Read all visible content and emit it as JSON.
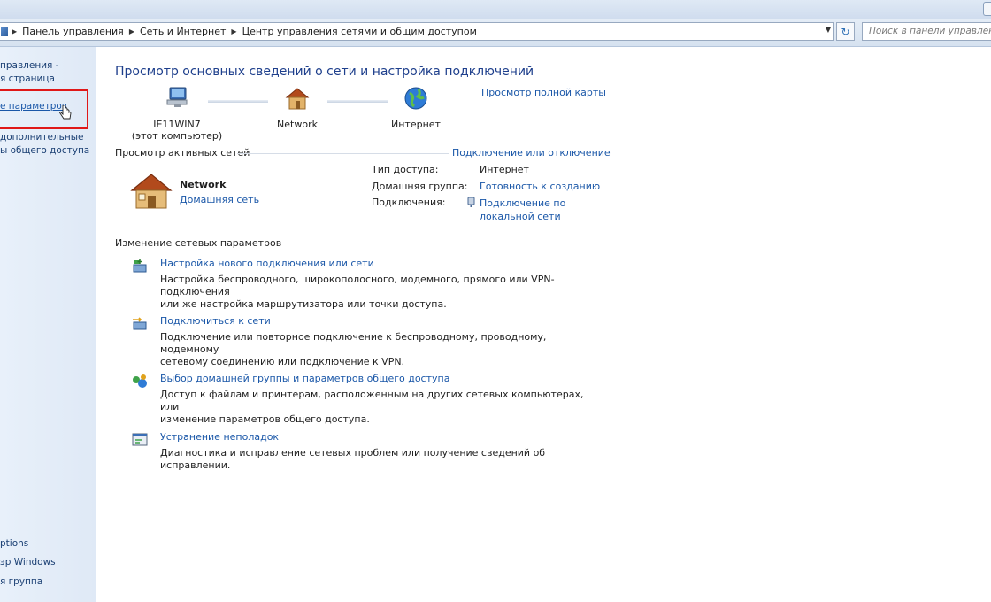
{
  "addressbar": {
    "crumbs": [
      "Панель управления",
      "Сеть и Интернет",
      "Центр управления сетями и общим доступом"
    ],
    "search_placeholder": "Поиск в панели управления"
  },
  "sidebar": {
    "items": [
      "правления -",
      "я страница",
      "е параметров",
      "дополнительные",
      "ы общего доступа"
    ],
    "see_also": [
      "ptions",
      "эр Windows",
      "я группа"
    ]
  },
  "main": {
    "title": "Просмотр основных сведений о сети и настройка подключений",
    "full_map_link": "Просмотр полной карты",
    "map": {
      "computer_name": "IE11WIN7",
      "computer_sub": "(этот компьютер)",
      "network_label": "Network",
      "internet_label": "Интернет"
    },
    "active_section": {
      "heading": "Просмотр активных сетей",
      "connect_link": "Подключение или отключение",
      "network_name": "Network",
      "network_type": "Домашняя сеть",
      "access_type_label": "Тип доступа:",
      "access_type_value": "Интернет",
      "homegroup_label": "Домашняя группа:",
      "homegroup_value": "Готовность к созданию",
      "connections_label": "Подключения:",
      "connections_value_1": "Подключение по",
      "connections_value_2": "локальной сети"
    },
    "change_section": {
      "heading": "Изменение сетевых параметров",
      "tasks": [
        {
          "title": "Настройка нового подключения или сети",
          "desc_1": "Настройка беспроводного, широкополосного, модемного, прямого или VPN-подключения",
          "desc_2": "или же настройка маршрутизатора или точки доступа."
        },
        {
          "title": "Подключиться к сети",
          "desc_1": "Подключение или повторное подключение к беспроводному, проводному, модемному",
          "desc_2": "сетевому соединению или подключение к VPN."
        },
        {
          "title": "Выбор домашней группы и параметров общего доступа",
          "desc_1": "Доступ к файлам и принтерам, расположенным на других сетевых компьютерах, или",
          "desc_2": "изменение параметров общего доступа."
        },
        {
          "title": "Устранение неполадок",
          "desc_1": "Диагностика и исправление сетевых проблем или получение сведений об исправлении.",
          "desc_2": ""
        }
      ]
    }
  },
  "colors": {
    "link": "#1a57a8",
    "title": "#1e3f8c",
    "highlight": "#e01818"
  }
}
